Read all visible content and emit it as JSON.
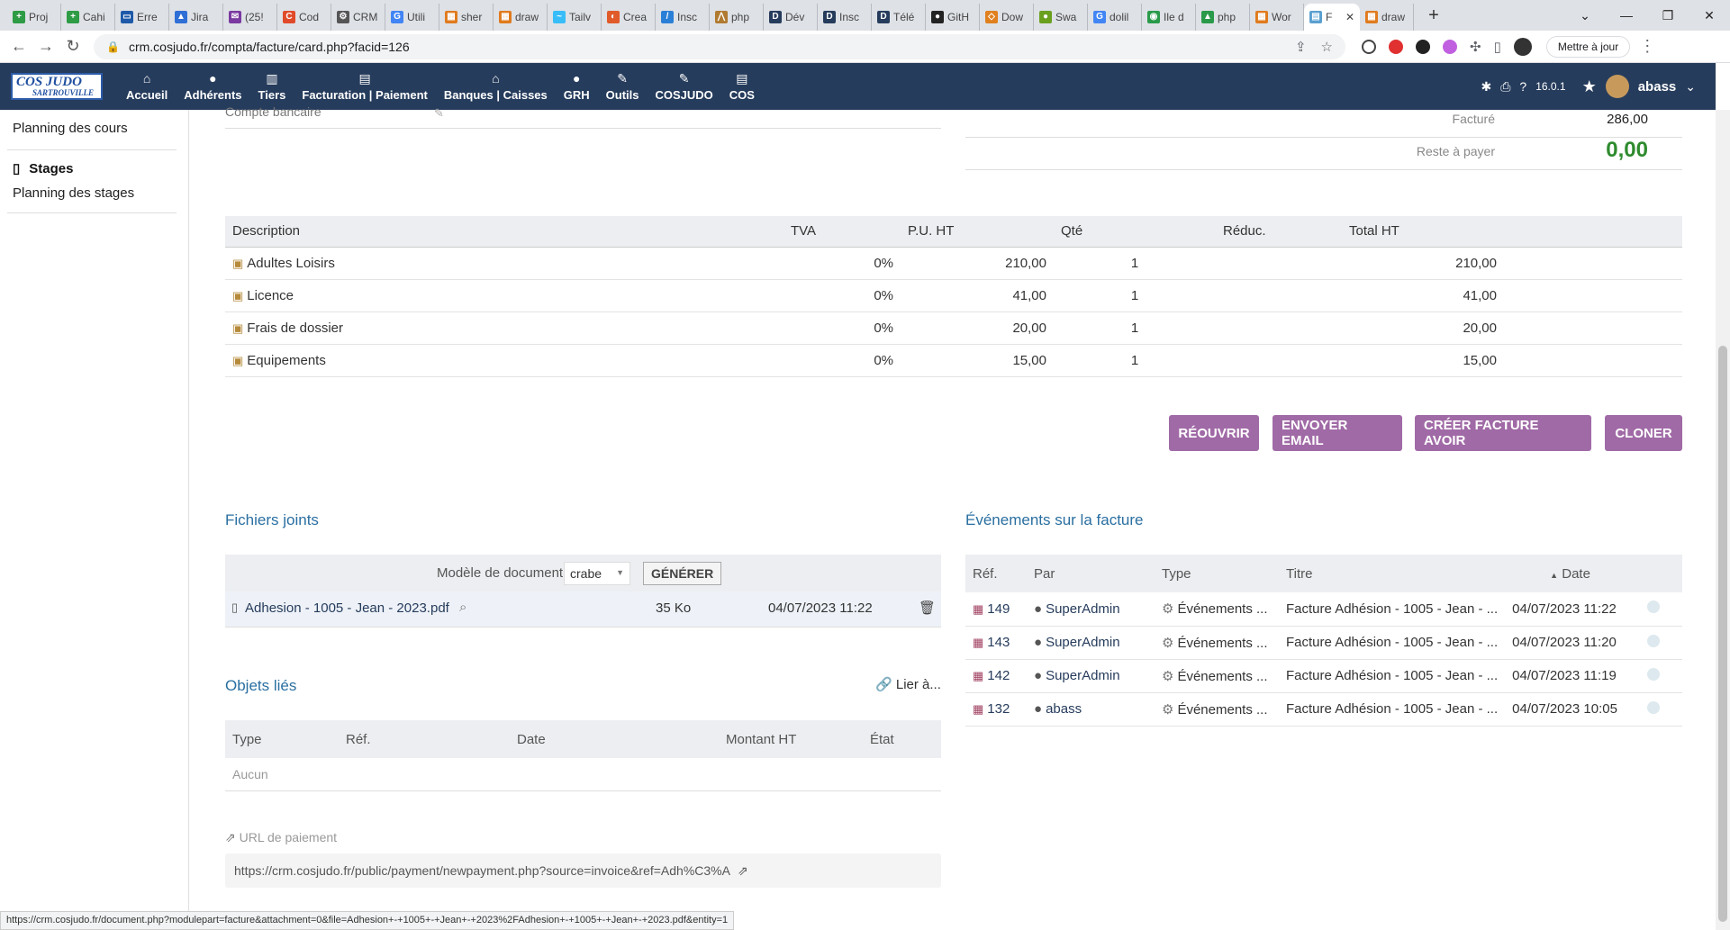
{
  "browser": {
    "tabs": [
      {
        "label": "Proj",
        "color": "#2e9b45",
        "glyph": "+"
      },
      {
        "label": "Cahi",
        "color": "#2e9b45",
        "glyph": "+"
      },
      {
        "label": "Erre",
        "color": "#1e5aa8",
        "glyph": "▭"
      },
      {
        "label": "Jira",
        "color": "#2f6fd6",
        "glyph": "▲"
      },
      {
        "label": "(25!",
        "color": "#7a3aa0",
        "glyph": "✉"
      },
      {
        "label": "Cod",
        "color": "#e04a2a",
        "glyph": "C"
      },
      {
        "label": "CRM",
        "color": "#555555",
        "glyph": "⚙"
      },
      {
        "label": "Utili",
        "color": "#4285f4",
        "glyph": "G"
      },
      {
        "label": "sher",
        "color": "#e07b1e",
        "glyph": "▦"
      },
      {
        "label": "draw",
        "color": "#e07b1e",
        "glyph": "▦"
      },
      {
        "label": "Tailv",
        "color": "#38bdf8",
        "glyph": "~"
      },
      {
        "label": "Crea",
        "color": "#e05a2a",
        "glyph": "◐"
      },
      {
        "label": "Insc",
        "color": "#2a7fd6",
        "glyph": "/"
      },
      {
        "label": "php",
        "color": "#b07a30",
        "glyph": "⋀"
      },
      {
        "label": "Dév",
        "color": "#263c5c",
        "glyph": "D"
      },
      {
        "label": "Insc",
        "color": "#263c5c",
        "glyph": "D"
      },
      {
        "label": "Télé",
        "color": "#263c5c",
        "glyph": "D"
      },
      {
        "label": "GitH",
        "color": "#222222",
        "glyph": "●"
      },
      {
        "label": "Dow",
        "color": "#e0801e",
        "glyph": "◇"
      },
      {
        "label": "Swa",
        "color": "#6aa01e",
        "glyph": "●"
      },
      {
        "label": "dolil",
        "color": "#4285f4",
        "glyph": "G"
      },
      {
        "label": "Ile d",
        "color": "#2a9a4a",
        "glyph": "◉"
      },
      {
        "label": "php",
        "color": "#2a9a4a",
        "glyph": "▲"
      },
      {
        "label": "Wor",
        "color": "#e07b1e",
        "glyph": "▦"
      },
      {
        "label": "F",
        "color": "#5aa0d0",
        "glyph": "▤",
        "active": true
      },
      {
        "label": "draw",
        "color": "#e07b1e",
        "glyph": "▦"
      }
    ],
    "url": "crm.cosjudo.fr/compta/facture/card.php?facid=126",
    "update_label": "Mettre à jour"
  },
  "logo": {
    "line1": "COS JUDO",
    "line2": "SARTROUVILLE"
  },
  "menu": [
    {
      "label": "Accueil",
      "icon": "⌂"
    },
    {
      "label": "Adhérents",
      "icon": "●"
    },
    {
      "label": "Tiers",
      "icon": "▥"
    },
    {
      "label": "Facturation | Paiement",
      "icon": "▤"
    },
    {
      "label": "Banques | Caisses",
      "icon": "⌂"
    },
    {
      "label": "GRH",
      "icon": "●"
    },
    {
      "label": "Outils",
      "icon": "✎"
    },
    {
      "label": "COSJUDO",
      "icon": "✎"
    },
    {
      "label": "COS",
      "icon": "▤"
    }
  ],
  "topright": {
    "version": "16.0.1",
    "user": "abass"
  },
  "sidebar": {
    "link1": "Planning des cours",
    "head": "Stages",
    "link2": "Planning des stages"
  },
  "summary": {
    "field_label": "Compte bancaire",
    "billed_label": "Facturé",
    "billed_value": "286,00",
    "rest_label": "Reste à payer",
    "rest_value": "0,00"
  },
  "lines": {
    "headers": [
      "Description",
      "TVA",
      "P.U. HT",
      "Qté",
      "Réduc.",
      "Total HT"
    ],
    "rows": [
      [
        "Adultes Loisirs",
        "0%",
        "210,00",
        "1",
        "",
        "210,00"
      ],
      [
        "Licence",
        "0%",
        "41,00",
        "1",
        "",
        "41,00"
      ],
      [
        "Frais de dossier",
        "0%",
        "20,00",
        "1",
        "",
        "20,00"
      ],
      [
        "Equipements",
        "0%",
        "15,00",
        "1",
        "",
        "15,00"
      ]
    ]
  },
  "actions": {
    "reopen": "RÉOUVRIR",
    "email": "ENVOYER EMAIL",
    "credit": "CRÉER FACTURE AVOIR",
    "clone": "CLONER"
  },
  "files": {
    "title": "Fichiers joints",
    "model_label": "Modèle de document",
    "model_value": "crabe",
    "generate": "GÉNÉRER",
    "name": "Adhesion - 1005 - Jean - 2023.pdf",
    "size": "35 Ko",
    "date": "04/07/2023 11:22"
  },
  "events": {
    "title": "Événements sur la facture",
    "headers": [
      "Réf.",
      "Par",
      "Type",
      "Titre",
      "Date"
    ],
    "rows": [
      [
        "149",
        "SuperAdmin",
        "Événements ...",
        "Facture Adhésion - 1005 - Jean - ...",
        "04/07/2023 11:22"
      ],
      [
        "143",
        "SuperAdmin",
        "Événements ...",
        "Facture Adhésion - 1005 - Jean - ...",
        "04/07/2023 11:20"
      ],
      [
        "142",
        "SuperAdmin",
        "Événements ...",
        "Facture Adhésion - 1005 - Jean - ...",
        "04/07/2023 11:19"
      ],
      [
        "132",
        "abass",
        "Événements ...",
        "Facture Adhésion - 1005 - Jean - ...",
        "04/07/2023 10:05"
      ]
    ]
  },
  "objects": {
    "title": "Objets liés",
    "link": "Lier à...",
    "headers": [
      "Type",
      "Réf.",
      "Date",
      "Montant HT",
      "État"
    ],
    "empty": "Aucun"
  },
  "payment": {
    "label": "URL de paiement",
    "url": "https://crm.cosjudo.fr/public/payment/newpayment.php?source=invoice&ref=Adh%C3%A"
  },
  "status": "https://crm.cosjudo.fr/document.php?modulepart=facture&attachment=0&file=Adhesion+-+1005+-+Jean+-+2023%2FAdhesion+-+1005+-+Jean+-+2023.pdf&entity=1"
}
